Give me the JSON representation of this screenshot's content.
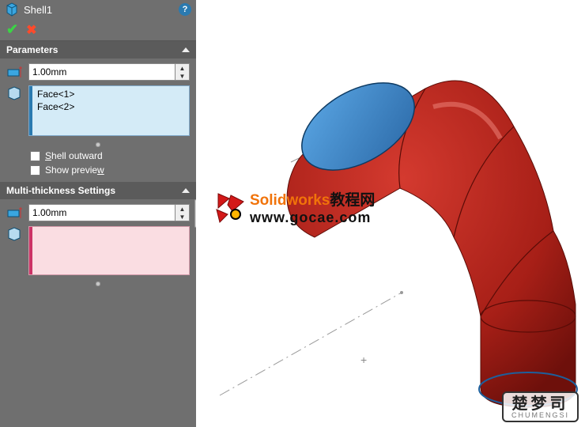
{
  "feature": {
    "name": "Shell1"
  },
  "sections": {
    "parameters": {
      "title": "Parameters",
      "thickness": "1.00mm",
      "faces": [
        "Face<1>",
        "Face<2>"
      ],
      "shell_outward": {
        "label_pre": "S",
        "label_rest": "hell outward",
        "checked": false
      },
      "show_preview": {
        "label_pre": "Show previe",
        "label_rest": "w",
        "checked": false
      }
    },
    "multi": {
      "title": "Multi-thickness Settings",
      "thickness": "1.00mm"
    }
  },
  "watermark1": {
    "brand_a": "Solidworks",
    "brand_b": "教程网",
    "url": "www.gocae.com"
  },
  "watermark2": {
    "cn": "楚梦司",
    "en": "CHUMENGSI"
  }
}
